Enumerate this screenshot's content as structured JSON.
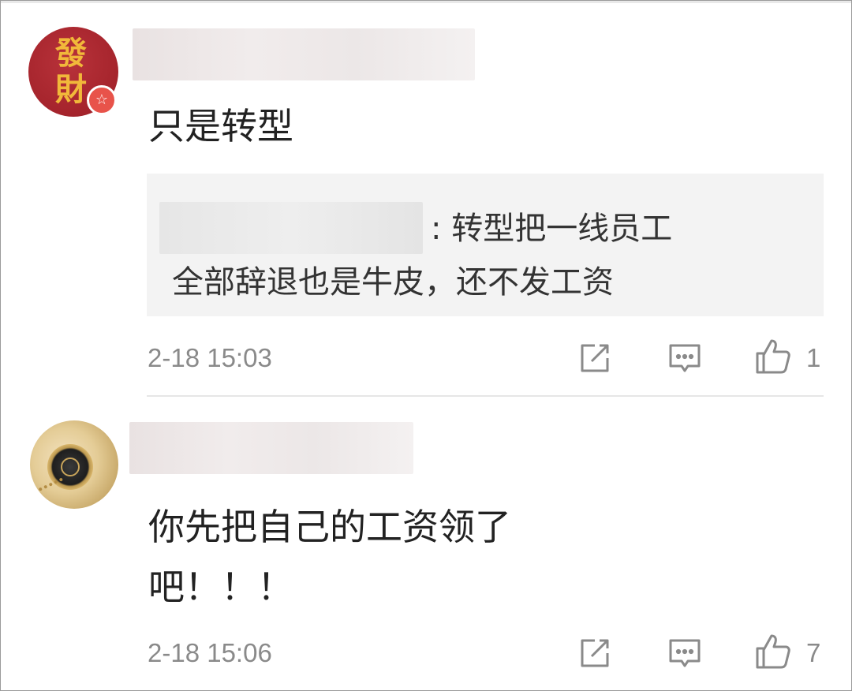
{
  "comments": [
    {
      "avatar": {
        "characters": [
          "發",
          "財"
        ],
        "badge_icon": "star-icon",
        "color": "#a82a31",
        "glyph_color": "#f1b83a"
      },
      "username": "",
      "text": "只是转型",
      "quote": {
        "username": "",
        "line1": ": 转型把一线员工",
        "line2": "全部辞退也是牛皮，还不发工资"
      },
      "time": "2-18 15:03",
      "actions": {
        "share_icon": "share-icon",
        "reply_icon": "comment-icon",
        "like_icon": "thumbs-up-icon",
        "likes": "1"
      }
    },
    {
      "avatar": {
        "image": "pocket-watch"
      },
      "username": "",
      "text": "你先把自己的工资领了\n吧！！！",
      "time": "2-18 15:06",
      "actions": {
        "share_icon": "share-icon",
        "reply_icon": "comment-icon",
        "like_icon": "thumbs-up-icon",
        "likes": "7"
      }
    }
  ]
}
